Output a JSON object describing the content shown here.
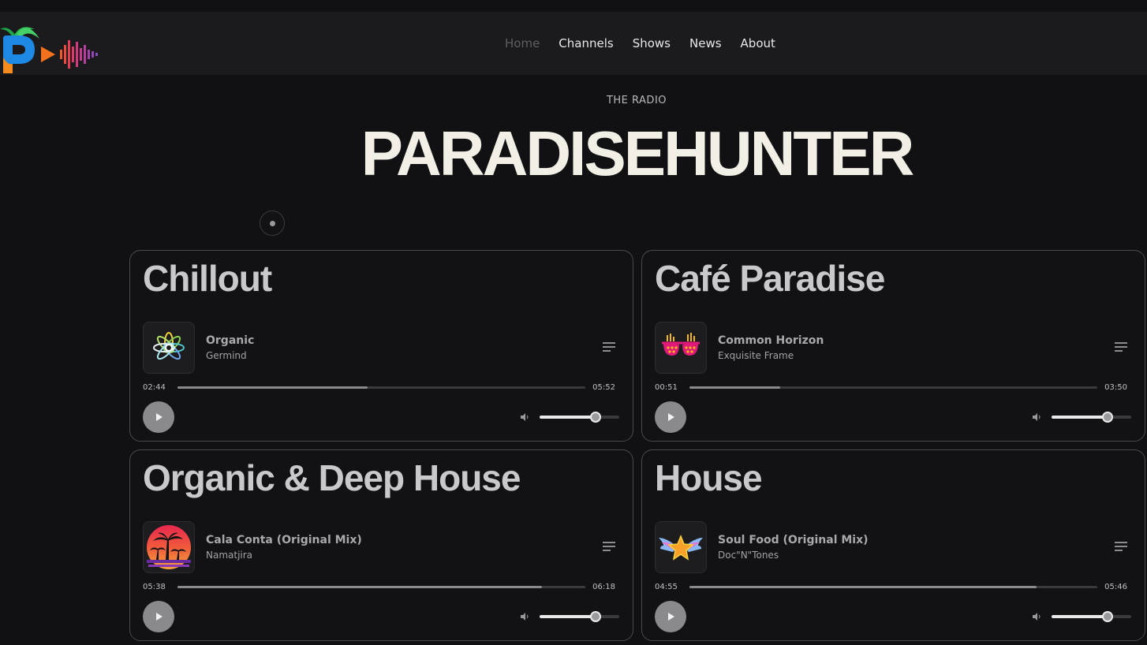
{
  "nav": {
    "items": [
      {
        "label": "Home",
        "active": true
      },
      {
        "label": "Channels",
        "active": false
      },
      {
        "label": "Shows",
        "active": false
      },
      {
        "label": "News",
        "active": false
      },
      {
        "label": "About",
        "active": false
      }
    ]
  },
  "hero": {
    "kicker": "THE RADIO",
    "title": "PARADISEHUNTER"
  },
  "channels": [
    {
      "name": "Chillout",
      "track": "Organic",
      "artist": "Germind",
      "current_time": "02:44",
      "total_time": "05:52",
      "progress": 0.466,
      "volume": 0.7,
      "cover_icon": "lotus-icon"
    },
    {
      "name": "Café Paradise",
      "track": "Common Horizon",
      "artist": "Exquisite Frame",
      "current_time": "00:51",
      "total_time": "03:50",
      "progress": 0.222,
      "volume": 0.7,
      "cover_icon": "sunglasses-icon"
    },
    {
      "name": "Organic & Deep House",
      "track": "Cala Conta (Original Mix)",
      "artist": "Namatjira",
      "current_time": "05:38",
      "total_time": "06:18",
      "progress": 0.894,
      "volume": 0.7,
      "cover_icon": "palm-sunset-icon"
    },
    {
      "name": "House",
      "track": "Soul Food (Original Mix)",
      "artist": "Doc\"N\"Tones",
      "current_time": "04:55",
      "total_time": "05:46",
      "progress": 0.852,
      "volume": 0.7,
      "cover_icon": "winged-star-icon"
    }
  ],
  "colors": {
    "background": "#111113",
    "navbar": "#1b1b1d",
    "card_border": "#4a4a4e",
    "hero_text": "#f1efe6"
  }
}
